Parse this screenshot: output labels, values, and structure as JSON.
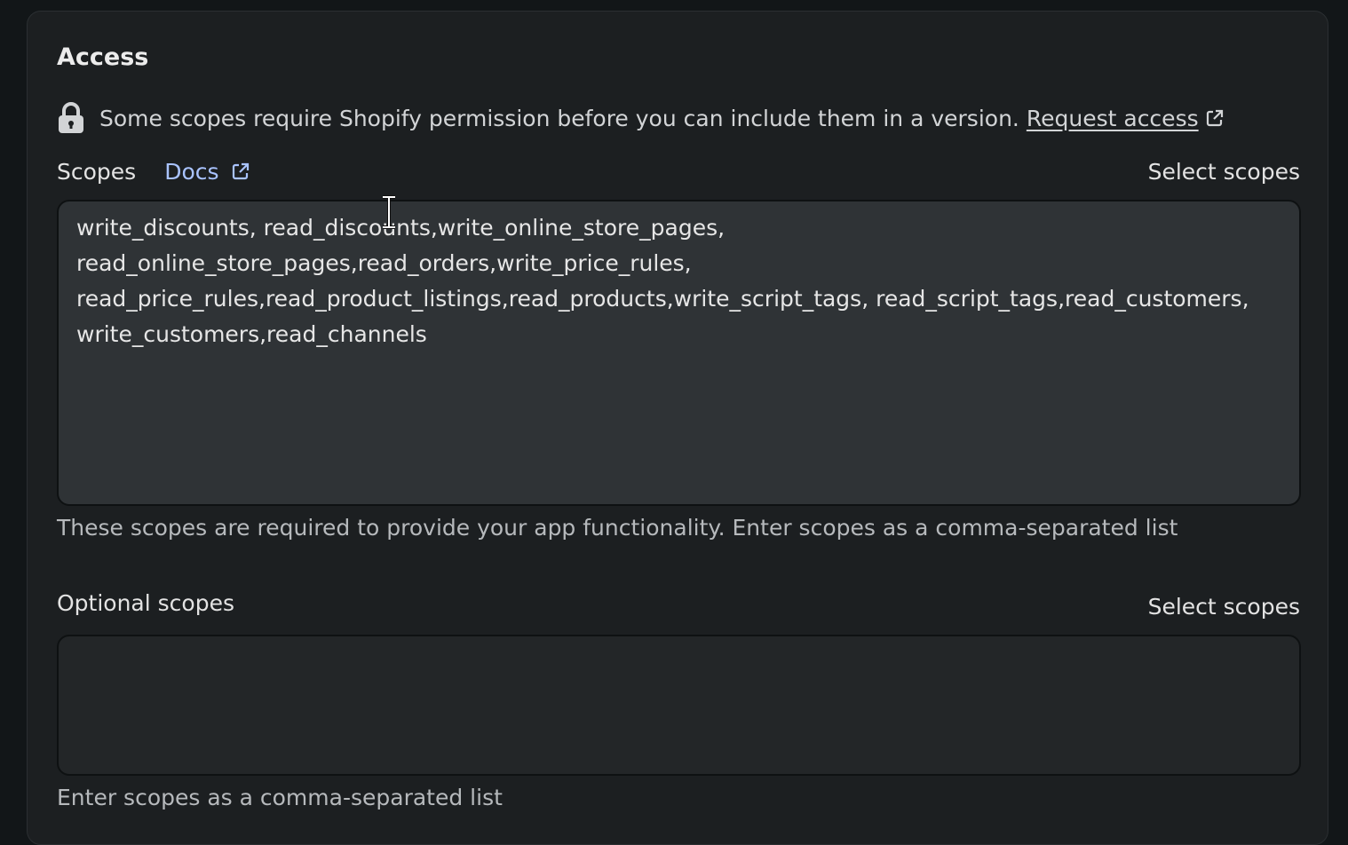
{
  "access": {
    "title": "Access",
    "notice_text": "Some scopes require Shopify permission before you can include them in a version.",
    "request_access_label": "Request access"
  },
  "scopes": {
    "label": "Scopes",
    "docs_label": "Docs",
    "select_label": "Select scopes",
    "value": "write_discounts, read_discounts,write_online_store_pages,\nread_online_store_pages,read_orders,write_price_rules,\nread_price_rules,read_product_listings,read_products,write_script_tags, read_script_tags,read_customers,\nwrite_customers,read_channels",
    "help": "These scopes are required to provide your app functionality. Enter scopes as a comma-separated list"
  },
  "optional_scopes": {
    "label": "Optional scopes",
    "select_label": "Select scopes",
    "value": "",
    "help": "Enter scopes as a comma-separated list"
  },
  "icons": {
    "lock": "lock-icon",
    "external": "external-link-icon",
    "cursor": "text-cursor-icon"
  },
  "colors": {
    "background": "#121618",
    "card": "#1c1f21",
    "textarea": "#2f3336",
    "link": "#a9c3ff"
  }
}
